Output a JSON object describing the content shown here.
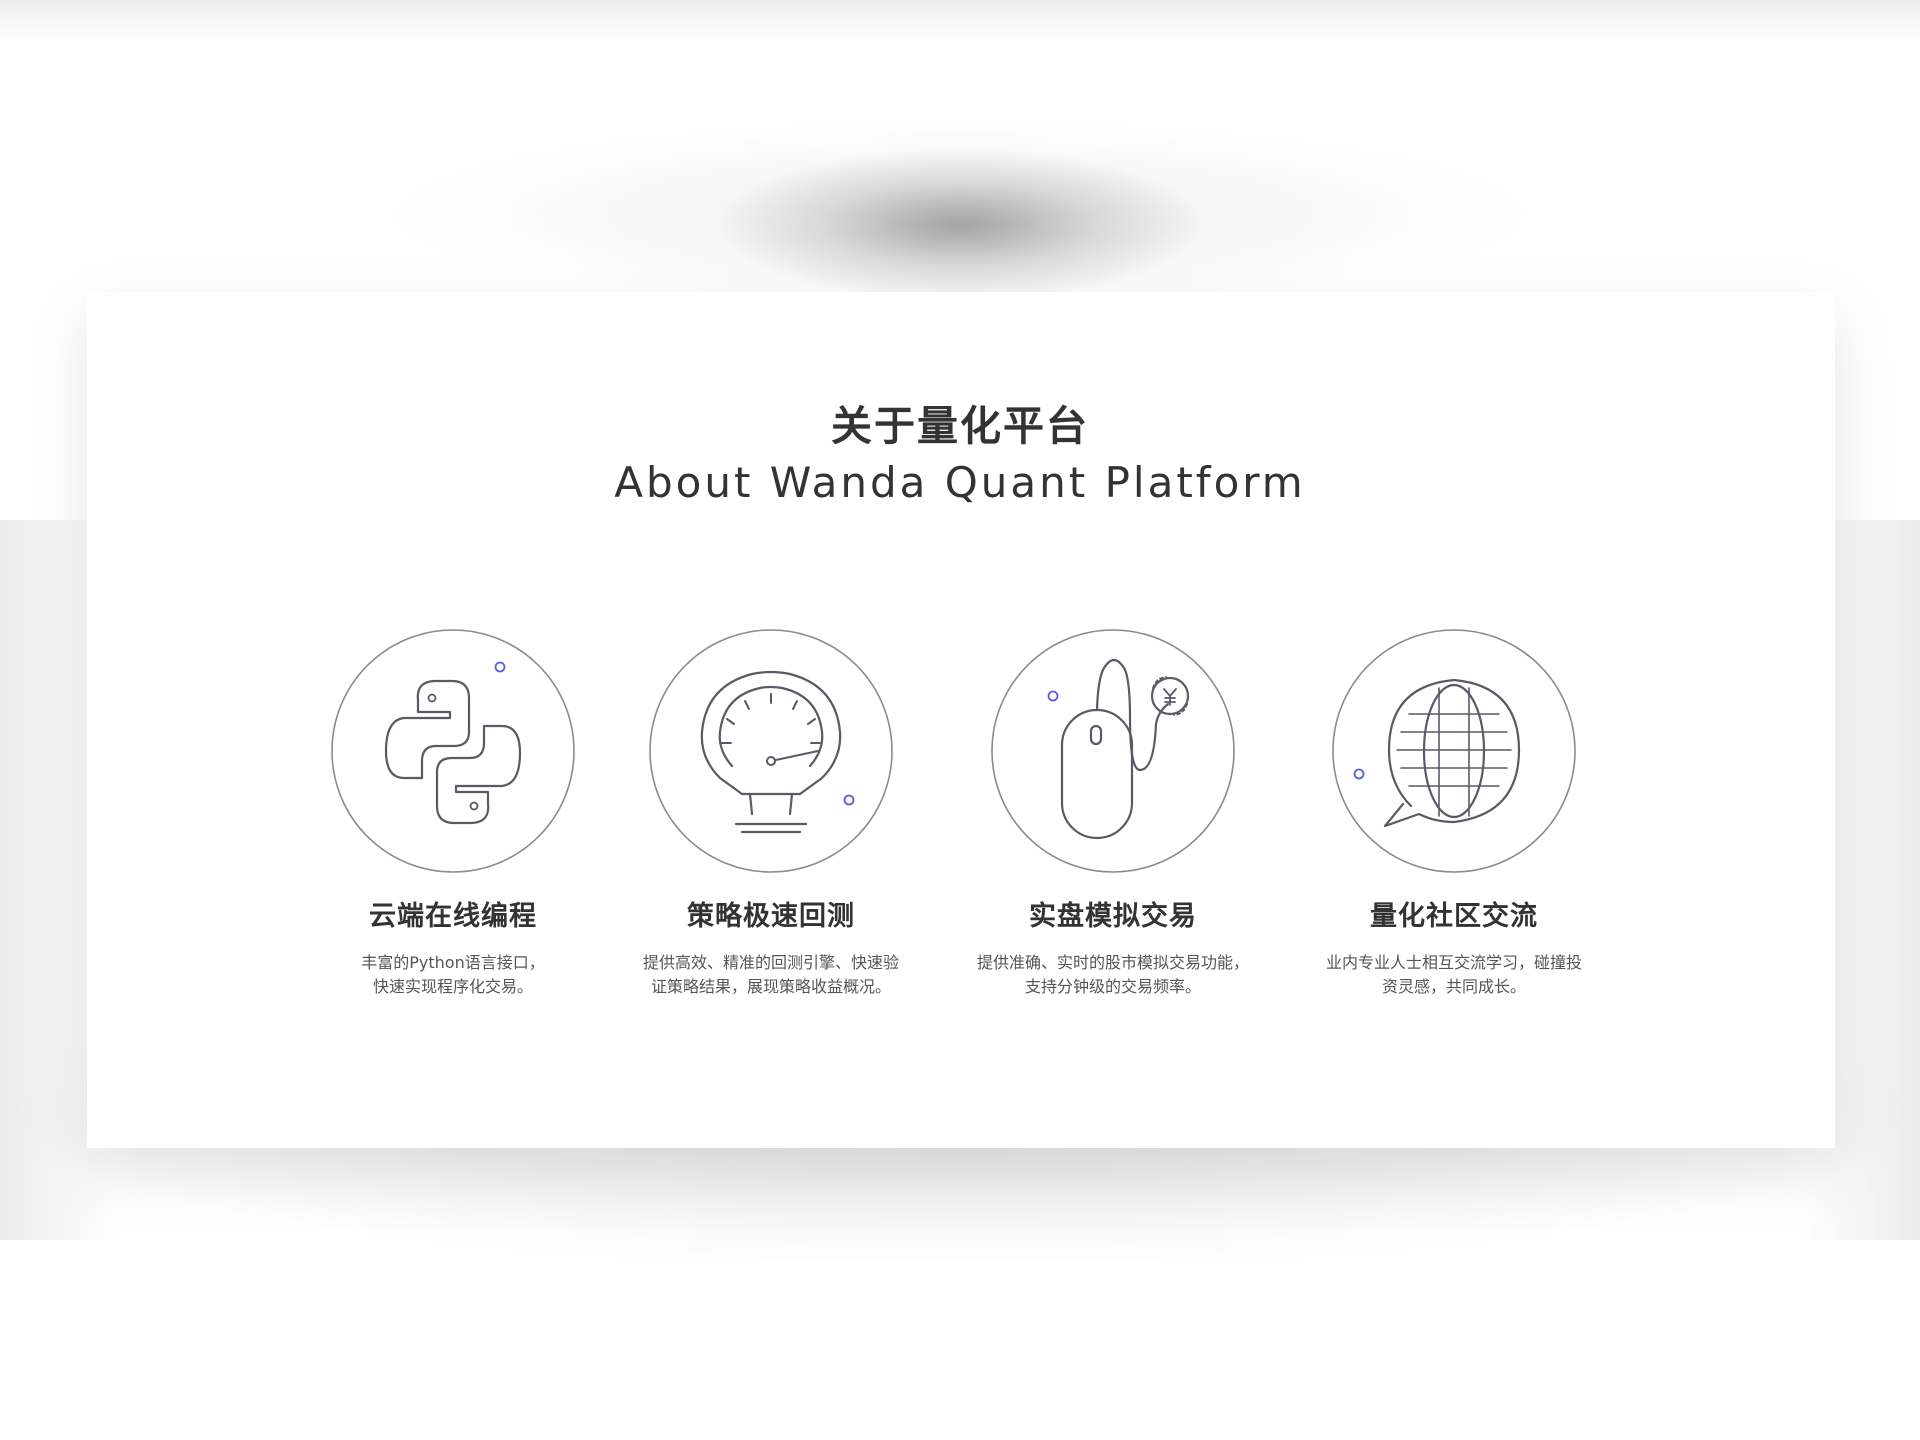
{
  "header": {
    "title_zh": "关于量化平台",
    "title_en": "About Wanda Quant Platform"
  },
  "features": [
    {
      "icon": "python-icon",
      "title": "云端在线编程",
      "desc_line1": "丰富的Python语言接口，",
      "desc_line2": "快速实现程序化交易。"
    },
    {
      "icon": "speedometer-icon",
      "title": "策略极速回测",
      "desc_line1": "提供高效、精准的回测引擎、快速验",
      "desc_line2": "证策略结果，展现策略收益概况。"
    },
    {
      "icon": "mouse-yuan-icon",
      "title": "实盘模拟交易",
      "desc_line1": "提供准确、实时的股市模拟交易功能，",
      "desc_line2": "支持分钟级的交易频率。"
    },
    {
      "icon": "globe-chat-icon",
      "title": "量化社区交流",
      "desc_line1": "业内专业人士相互交流学习，碰撞投",
      "desc_line2": "资灵感，共同成长。"
    }
  ],
  "colors": {
    "text": "#333333",
    "desc_text": "#555555",
    "line": "#8a8a92",
    "accent_dot": "#5b5fd6",
    "background": "#ffffff"
  }
}
